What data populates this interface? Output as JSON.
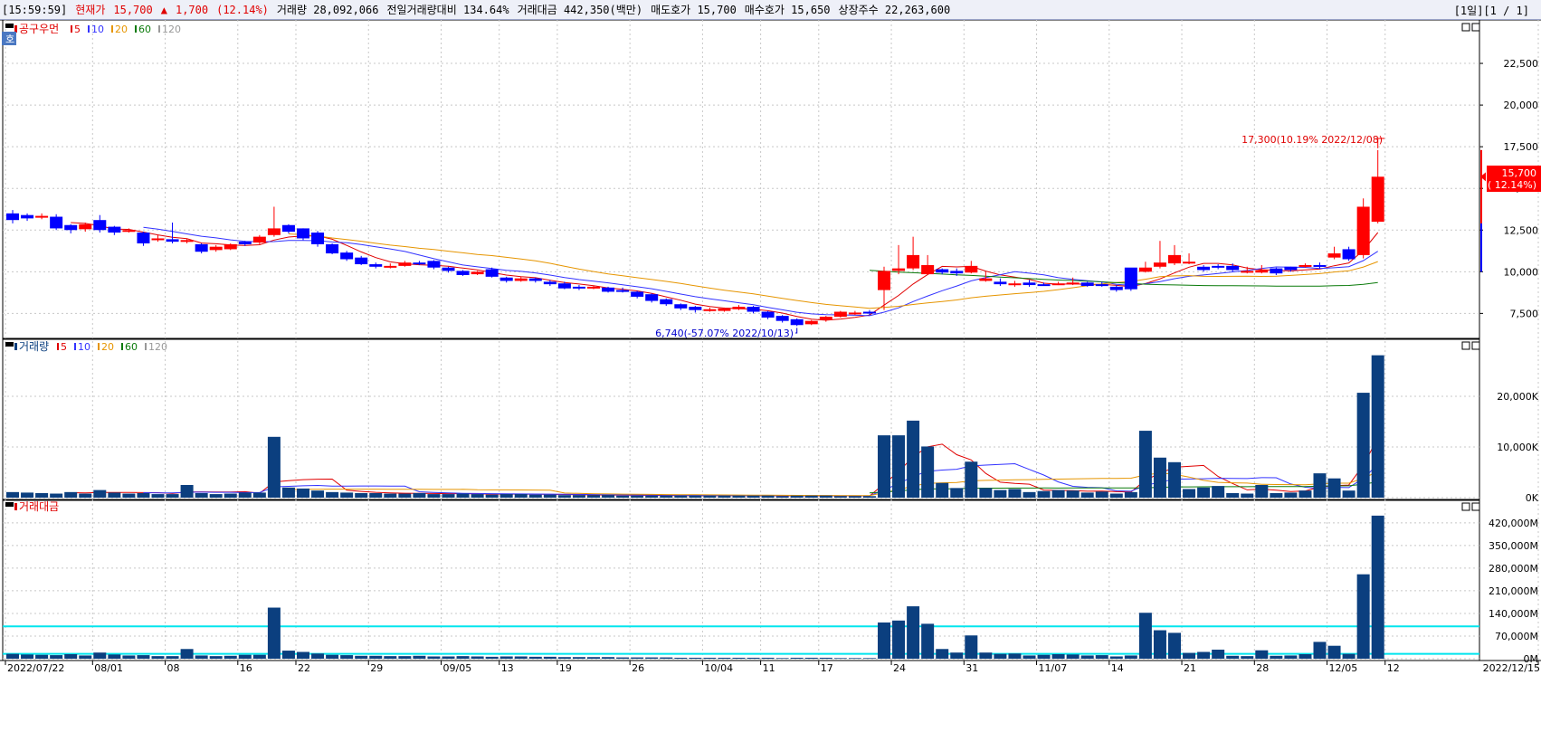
{
  "header": {
    "time": "[15:59:59]",
    "price_label": "현재가",
    "price": "15,700",
    "arrow": "▲",
    "change": "1,700",
    "change_pct": "(12.14%)",
    "volume": "거래량 28,092,066",
    "prev_volume_ratio": "전일거래량대비 134.64%",
    "trade_amount": "거래대금 442,350(백만)",
    "ask": "매도호가 15,700",
    "bid": "매수호가 15,650",
    "shares": "상장주수 22,263,600",
    "paging": "[1일][1 / 1]"
  },
  "colors": {
    "up": "#ff0000",
    "down": "#0000ff",
    "volume_bar": "#0b3f7f",
    "ma5": "#e00000",
    "ma10": "#3333ff",
    "ma20": "#e69500",
    "ma60": "#0a7a0a",
    "ma120": "#999999",
    "cyan_line": "#00e5ee",
    "grid": "#c8c8c8"
  },
  "panels": {
    "price": {
      "title": "공구우먼",
      "legend": [
        {
          "name": "5",
          "color": "#e00000"
        },
        {
          "name": "10",
          "color": "#3333ff"
        },
        {
          "name": "20",
          "color": "#e69500"
        },
        {
          "name": "60",
          "color": "#0a7a0a"
        },
        {
          "name": "120",
          "color": "#999999"
        }
      ],
      "axis_labels": [
        "22,500",
        "20,000",
        "17,500",
        "15,000",
        "12,500",
        "10,000",
        "7,500"
      ],
      "high_annotation": "17,300(10.19% 2022/12/08)",
      "low_annotation": "6,740(-57.07% 2022/10/13)",
      "current_box_price": "15,700",
      "current_box_pct": "( 12.14%)"
    },
    "volume": {
      "title": "거래량",
      "legend": [
        {
          "name": "5",
          "color": "#e00000"
        },
        {
          "name": "10",
          "color": "#3333ff"
        },
        {
          "name": "20",
          "color": "#e69500"
        },
        {
          "name": "60",
          "color": "#0a7a0a"
        },
        {
          "name": "120",
          "color": "#999999"
        }
      ],
      "axis_labels": [
        "20,000K",
        "10,000K",
        "0K"
      ]
    },
    "amount": {
      "title": "거래대금",
      "axis_labels": [
        "420,000M",
        "350,000M",
        "280,000M",
        "210,000M",
        "140,000M",
        "70,000M",
        "0M"
      ]
    }
  },
  "x_axis": {
    "labels": [
      "2022/07/22",
      "08/01",
      "08",
      "16",
      "22",
      "29",
      "09/05",
      "13",
      "19",
      "26",
      "10/04",
      "11",
      "17",
      "24",
      "31",
      "11/07",
      "14",
      "21",
      "28",
      "12/05",
      "12",
      "2022/12/15"
    ]
  },
  "chart_data": {
    "type": "candlestick",
    "dates": [
      "2022/07/22",
      "07/25",
      "07/26",
      "07/27",
      "07/28",
      "07/29",
      "08/01",
      "08/02",
      "08/03",
      "08/04",
      "08/05",
      "08/08",
      "08/09",
      "08/10",
      "08/11",
      "08/12",
      "08/16",
      "08/17",
      "08/18",
      "08/19",
      "08/22",
      "08/23",
      "08/24",
      "08/25",
      "08/26",
      "08/29",
      "08/30",
      "08/31",
      "09/01",
      "09/02",
      "09/05",
      "09/06",
      "09/07",
      "09/08",
      "09/13",
      "09/14",
      "09/15",
      "09/16",
      "09/19",
      "09/20",
      "09/21",
      "09/22",
      "09/23",
      "09/26",
      "09/27",
      "09/28",
      "09/29",
      "09/30",
      "10/04",
      "10/05",
      "10/06",
      "10/07",
      "10/11",
      "10/12",
      "10/13",
      "10/14",
      "10/17",
      "10/18",
      "10/19",
      "10/20",
      "10/21",
      "10/24",
      "10/25",
      "10/26",
      "10/27",
      "10/28",
      "10/31",
      "11/01",
      "11/02",
      "11/03",
      "11/04",
      "11/07",
      "11/08",
      "11/09",
      "11/10",
      "11/11",
      "11/14",
      "11/15",
      "11/16",
      "11/17",
      "11/18",
      "11/21",
      "11/22",
      "11/23",
      "11/24",
      "11/25",
      "11/28",
      "11/29",
      "11/30",
      "12/01",
      "12/02",
      "12/05",
      "12/06",
      "12/07",
      "12/08"
    ],
    "price": {
      "open": [
        13500,
        13400,
        13250,
        13300,
        12800,
        12550,
        13100,
        12700,
        12450,
        12350,
        11950,
        11950,
        11850,
        11650,
        11300,
        11350,
        11800,
        11750,
        12200,
        12800,
        12600,
        12350,
        11650,
        11150,
        10850,
        10450,
        10250,
        10350,
        10550,
        10650,
        10250,
        10050,
        9850,
        10150,
        9650,
        9450,
        9600,
        9400,
        9300,
        9100,
        9000,
        9050,
        8900,
        8800,
        8650,
        8350,
        8050,
        7900,
        7750,
        7650,
        7750,
        7900,
        7600,
        7350,
        7150,
        6850,
        7100,
        7300,
        7500,
        7600,
        8900,
        10050,
        10200,
        9850,
        10150,
        10050,
        9950,
        9450,
        9400,
        9200,
        9350,
        9250,
        9250,
        9250,
        9350,
        9250,
        9100,
        10250,
        10000,
        10300,
        10500,
        10550,
        10300,
        10350,
        10350,
        9950,
        9950,
        10200,
        10300,
        10350,
        10400,
        10850,
        11350,
        11000,
        13000
      ],
      "close": [
        13100,
        13200,
        13350,
        12600,
        12500,
        12850,
        12500,
        12350,
        12500,
        11700,
        12000,
        11800,
        11900,
        11200,
        11500,
        11650,
        11650,
        12100,
        12600,
        12400,
        12000,
        11650,
        11100,
        10750,
        10450,
        10300,
        10350,
        10550,
        10450,
        10250,
        10050,
        9800,
        10000,
        9700,
        9450,
        9600,
        9450,
        9250,
        9000,
        9000,
        9100,
        8800,
        8850,
        8500,
        8250,
        8050,
        7800,
        7700,
        7750,
        7800,
        7900,
        7600,
        7250,
        7050,
        6800,
        7050,
        7300,
        7600,
        7550,
        7500,
        10050,
        10200,
        11000,
        10400,
        9950,
        9900,
        10350,
        9600,
        9250,
        9300,
        9200,
        9200,
        9300,
        9350,
        9150,
        9200,
        8900,
        8950,
        10250,
        10550,
        11000,
        10600,
        10100,
        10250,
        10100,
        10050,
        10100,
        9900,
        10100,
        10400,
        10300,
        11100,
        10750,
        13900,
        15700
      ],
      "high": [
        13700,
        13500,
        13500,
        13450,
        12850,
        12950,
        13400,
        12750,
        12600,
        12400,
        12200,
        12950,
        12000,
        11700,
        11600,
        11700,
        11850,
        12200,
        13900,
        12850,
        12600,
        12450,
        11700,
        11250,
        10950,
        10550,
        10500,
        10650,
        10650,
        10700,
        10300,
        10100,
        10050,
        10250,
        9700,
        9700,
        9650,
        9500,
        9400,
        9200,
        9150,
        9100,
        9050,
        8850,
        8700,
        8400,
        8100,
        7950,
        7850,
        7850,
        8000,
        7950,
        7650,
        7400,
        7200,
        7100,
        7350,
        7650,
        7650,
        7700,
        10300,
        11600,
        12100,
        11000,
        10200,
        10200,
        10650,
        10000,
        9600,
        9450,
        9500,
        9350,
        9400,
        9650,
        9400,
        9400,
        9200,
        9300,
        10600,
        11850,
        11600,
        11100,
        10400,
        10450,
        10500,
        10300,
        10400,
        10250,
        10300,
        10500,
        10550,
        11500,
        11500,
        14400,
        17300
      ],
      "low": [
        12900,
        13050,
        13150,
        12500,
        12300,
        12400,
        12350,
        12200,
        12350,
        11550,
        11800,
        11700,
        11700,
        11100,
        11200,
        11300,
        11550,
        11650,
        12100,
        12300,
        11900,
        11500,
        11050,
        10650,
        10400,
        10200,
        10200,
        10300,
        10400,
        10150,
        9950,
        9750,
        9800,
        9650,
        9350,
        9400,
        9350,
        9150,
        8950,
        8900,
        8950,
        8750,
        8750,
        8400,
        8150,
        7950,
        7700,
        7550,
        7600,
        7600,
        7700,
        7500,
        7150,
        6950,
        6740,
        6800,
        7000,
        7250,
        7400,
        7400,
        7700,
        9850,
        10100,
        10200,
        9850,
        9750,
        9900,
        9400,
        9150,
        9100,
        9100,
        9150,
        9200,
        9200,
        9100,
        9100,
        8800,
        8850,
        9950,
        10200,
        10400,
        10450,
        10000,
        10150,
        10000,
        9900,
        9900,
        9800,
        10000,
        10250,
        10200,
        10750,
        10650,
        10800,
        12900
      ]
    },
    "volume_k": [
      1100,
      1000,
      900,
      800,
      1100,
      800,
      1500,
      1000,
      800,
      900,
      700,
      700,
      2500,
      900,
      700,
      800,
      1000,
      1000,
      12000,
      2000,
      1800,
      1400,
      1100,
      1000,
      900,
      900,
      800,
      800,
      900,
      700,
      700,
      800,
      700,
      600,
      700,
      700,
      600,
      600,
      500,
      500,
      500,
      500,
      400,
      400,
      400,
      400,
      400,
      400,
      400,
      400,
      400,
      400,
      400,
      300,
      400,
      400,
      400,
      300,
      300,
      300,
      12300,
      12300,
      15200,
      10100,
      2900,
      1900,
      7100,
      1900,
      1500,
      1700,
      1100,
      1300,
      1500,
      1400,
      1000,
      1200,
      800,
      1100,
      13200,
      7900,
      7000,
      1700,
      2000,
      2300,
      900,
      800,
      2500,
      900,
      1000,
      1400,
      4800,
      3800,
      1400,
      20700,
      28100
    ],
    "amount_m": [
      15000,
      13000,
      12000,
      11000,
      14000,
      10000,
      19000,
      13000,
      10000,
      11000,
      8000,
      8000,
      30000,
      10000,
      8000,
      9000,
      12000,
      12000,
      158000,
      25000,
      21000,
      16000,
      12000,
      11000,
      9000,
      9000,
      8000,
      8000,
      9000,
      7000,
      7000,
      8000,
      7000,
      6000,
      7000,
      7000,
      6000,
      6000,
      5000,
      5000,
      5000,
      5000,
      4000,
      4000,
      4000,
      4000,
      3000,
      3000,
      3000,
      3000,
      3000,
      3000,
      3000,
      2000,
      3000,
      3000,
      3000,
      2000,
      2000,
      2000,
      112000,
      118000,
      162000,
      108000,
      30000,
      19000,
      72000,
      19000,
      15000,
      16000,
      10000,
      12000,
      14000,
      13000,
      10000,
      11000,
      7000,
      10000,
      142000,
      88000,
      80000,
      18000,
      21000,
      28000,
      9000,
      8000,
      26000,
      9000,
      10000,
      14000,
      52000,
      40000,
      15000,
      261000,
      442350
    ],
    "price_axis": {
      "min": 6000,
      "max": 25000
    },
    "volume_axis": {
      "min": 0,
      "max": 30000
    },
    "amount_axis": {
      "min": 0,
      "max": 470000
    },
    "amount_reference_lines": [
      100000,
      15000
    ],
    "high_point": {
      "date": "12/08",
      "value": 17300
    },
    "low_point": {
      "date": "10/13",
      "value": 6740
    },
    "last": {
      "price": 15700,
      "change": 1700,
      "pct": 12.14
    }
  }
}
